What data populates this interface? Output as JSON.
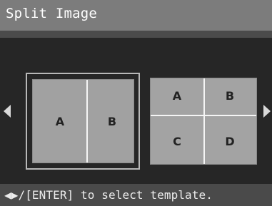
{
  "header": {
    "title": "Split Image"
  },
  "templates": [
    {
      "name": "two-split",
      "selected": true,
      "cells": [
        "A",
        "B"
      ]
    },
    {
      "name": "four-split",
      "selected": false,
      "cells": [
        "A",
        "B",
        "C",
        "D"
      ]
    }
  ],
  "navigation": {
    "left_icon": "left-arrow-icon",
    "right_icon": "right-arrow-icon"
  },
  "footer": {
    "hint": "◀▶/[ENTER] to select template."
  },
  "colors": {
    "title_bar": "#7c7c7c",
    "background": "#262626",
    "template_fill": "#a1a1a1",
    "selection_border": "#b8b8b8",
    "footer_bar": "#4a4a4a"
  }
}
